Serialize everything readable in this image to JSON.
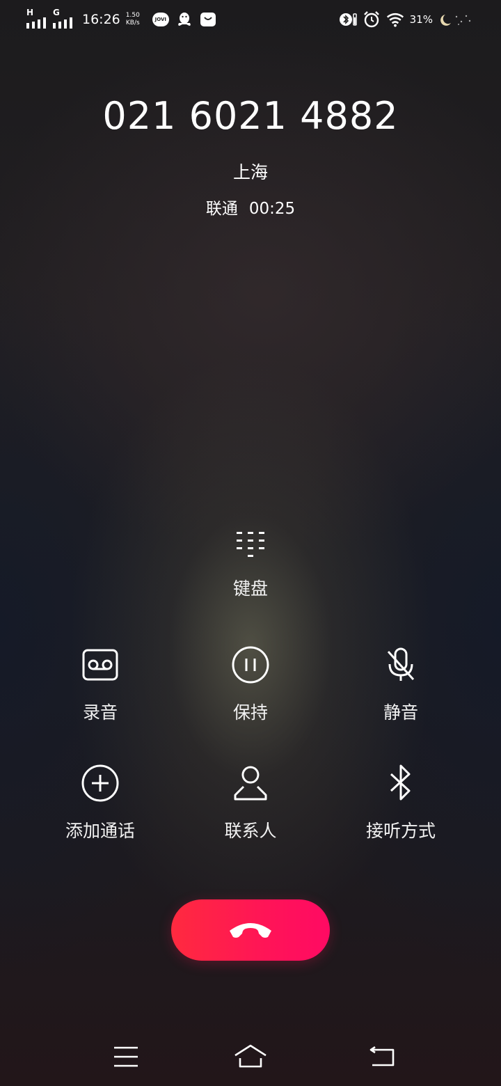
{
  "status_bar": {
    "network1": "H",
    "network2": "G",
    "time": "16:26",
    "speed_value": "1.50",
    "speed_unit": "KB/s",
    "app_jovi": "JOVI",
    "battery": "31%"
  },
  "caller": {
    "number": "021 6021 4882",
    "location": "上海",
    "carrier": "联通",
    "duration": "00:25"
  },
  "controls": {
    "keypad": {
      "label": "键盘",
      "icon": "dialpad-icon"
    },
    "record": {
      "label": "录音",
      "icon": "voicemail-icon"
    },
    "hold": {
      "label": "保持",
      "icon": "pause-icon"
    },
    "mute": {
      "label": "静音",
      "icon": "mic-off-icon"
    },
    "add_call": {
      "label": "添加通话",
      "icon": "add-circle-icon"
    },
    "contacts": {
      "label": "联系人",
      "icon": "person-icon"
    },
    "audio_route": {
      "label": "接听方式",
      "icon": "bluetooth-icon"
    }
  },
  "end_call": {
    "icon": "hang-up-icon",
    "color": "#ff1457"
  },
  "nav": {
    "menu": "menu-icon",
    "home": "home-icon",
    "back": "back-icon"
  }
}
